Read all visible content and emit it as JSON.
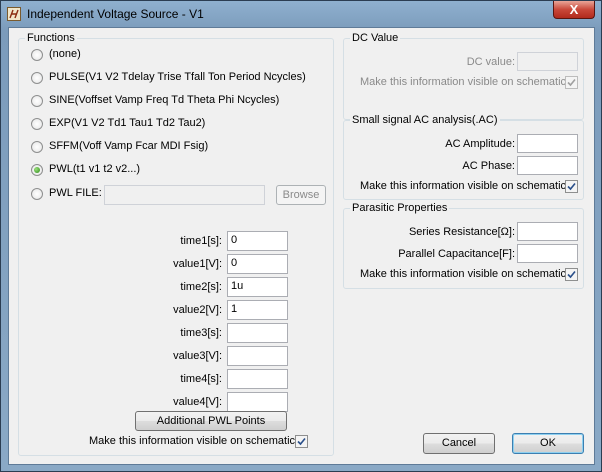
{
  "window": {
    "title": "Independent Voltage Source - V1",
    "close_label": "X"
  },
  "functions": {
    "title": "Functions",
    "options": [
      {
        "label": "(none)",
        "selected": false
      },
      {
        "label": "PULSE(V1 V2 Tdelay Trise Tfall Ton Period Ncycles)",
        "selected": false
      },
      {
        "label": "SINE(Voffset Vamp Freq Td Theta Phi Ncycles)",
        "selected": false
      },
      {
        "label": "EXP(V1 V2 Td1 Tau1 Td2 Tau2)",
        "selected": false
      },
      {
        "label": "SFFM(Voff Vamp Fcar MDI Fsig)",
        "selected": false
      },
      {
        "label": "PWL(t1 v1 t2 v2...)",
        "selected": true
      },
      {
        "label": "PWL FILE:",
        "selected": false
      }
    ],
    "pwl_file_value": "",
    "browse_label": "Browse",
    "params": [
      {
        "label": "time1[s]:",
        "value": "0"
      },
      {
        "label": "value1[V]:",
        "value": "0"
      },
      {
        "label": "time2[s]:",
        "value": "1u"
      },
      {
        "label": "value2[V]:",
        "value": "1"
      },
      {
        "label": "time3[s]:",
        "value": ""
      },
      {
        "label": "value3[V]:",
        "value": ""
      },
      {
        "label": "time4[s]:",
        "value": ""
      },
      {
        "label": "value4[V]:",
        "value": ""
      }
    ],
    "additional_label": "Additional PWL Points",
    "visible_label": "Make this information visible on schematic:",
    "visible_checked": true
  },
  "dc": {
    "title": "DC Value",
    "value_label": "DC value:",
    "value": "",
    "visible_label": "Make this information visible on schematic:",
    "visible_checked": true
  },
  "ac": {
    "title": "Small signal AC analysis(.AC)",
    "amplitude_label": "AC Amplitude:",
    "amplitude_value": "",
    "phase_label": "AC Phase:",
    "phase_value": "",
    "visible_label": "Make this information visible on schematic:",
    "visible_checked": true
  },
  "parasitic": {
    "title": "Parasitic Properties",
    "resistance_label": "Series Resistance[Ω]:",
    "resistance_value": "",
    "capacitance_label": "Parallel Capacitance[F]:",
    "capacitance_value": "",
    "visible_label": "Make this information visible on schematic:",
    "visible_checked": true
  },
  "buttons": {
    "cancel": "Cancel",
    "ok": "OK"
  }
}
